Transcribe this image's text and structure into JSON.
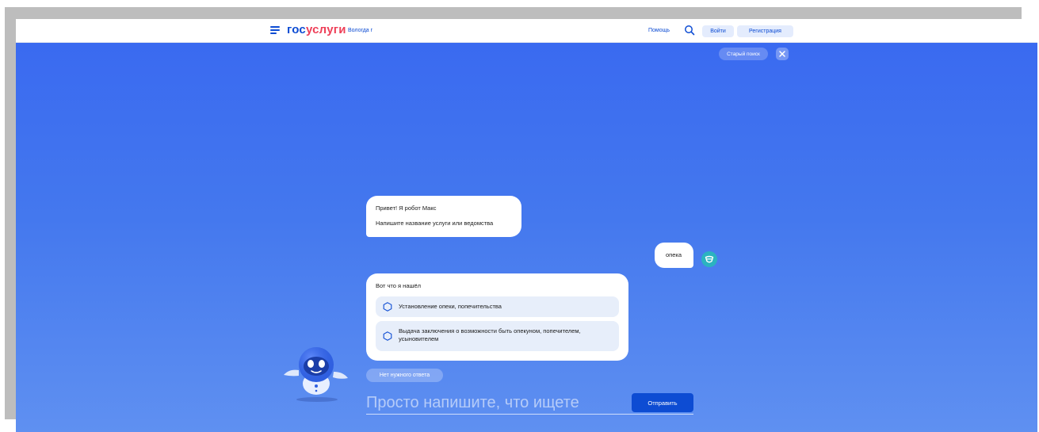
{
  "header": {
    "menu_icon": "burger-menu-icon",
    "logo_part1": "гос",
    "logo_part2": "услуги",
    "region": "Вологда г",
    "help": "Помощь",
    "search_icon": "search-icon",
    "login": "Войти",
    "register": "Регистрация"
  },
  "top_actions": {
    "old_search": "Старый поиск",
    "close_icon": "close-icon"
  },
  "chat": {
    "greeting_line1": "Привет! Я робот Макс",
    "greeting_line2": "Напишите название услуги или ведомства",
    "user_message": "опека",
    "user_avatar_icon": "user-avatar-icon",
    "results_title": "Вот что я нашёл",
    "options": [
      {
        "label": "Установление опеки, попечительства",
        "icon": "hexagon-icon"
      },
      {
        "label": "Выдача заключения о возможности быть опекуном, попечителем, усыновителем",
        "icon": "hexagon-icon"
      }
    ],
    "no_answer": "Нет нужного ответа"
  },
  "input": {
    "placeholder": "Просто напишите, что ищете",
    "value": "",
    "send": "Отправить"
  },
  "colors": {
    "brand_blue": "#0d4cd3",
    "brand_red": "#ee3f58",
    "background_top": "#3a6af0",
    "background_bottom": "#5f90f1"
  }
}
